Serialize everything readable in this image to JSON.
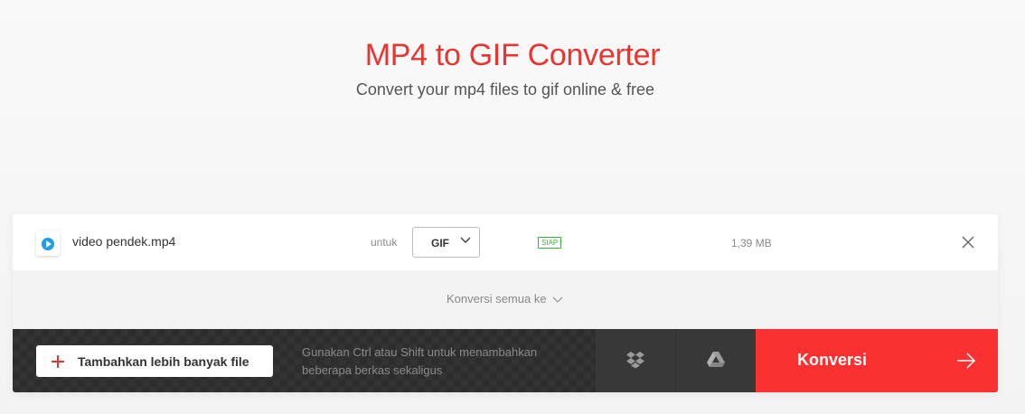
{
  "header": {
    "title": "MP4 to GIF Converter",
    "subtitle": "Convert your mp4 files to gif online & free"
  },
  "file": {
    "icon": "video-play-icon",
    "name": "video pendek.mp4",
    "to_label": "untuk",
    "format": "GIF",
    "status": "SIAP",
    "size": "1,39 MB"
  },
  "convert_all": {
    "label": "Konversi semua ke"
  },
  "action_bar": {
    "add_more_label": "Tambahkan lebih banyak file",
    "hint": "Gunakan Ctrl atau Shift untuk menambahkan beberapa berkas sekaligus",
    "convert_label": "Konversi"
  },
  "colors": {
    "accent": "#fb3031",
    "status": "#35b23c",
    "icon_blue": "#1e9be9"
  }
}
